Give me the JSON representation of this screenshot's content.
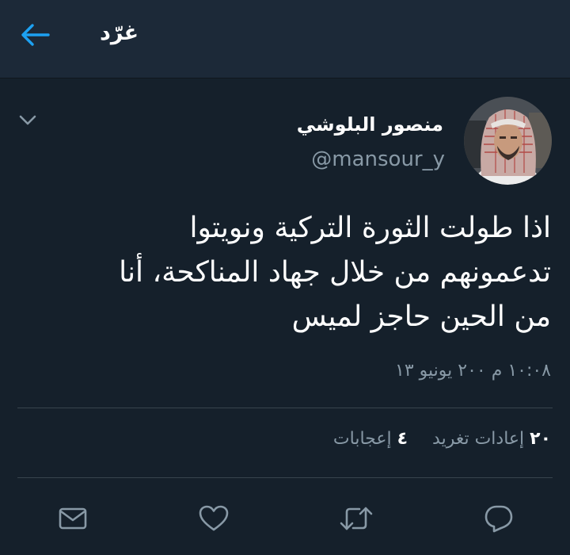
{
  "header": {
    "title": "غرّد"
  },
  "tweet": {
    "display_name": "منصور البلوشي",
    "handle": "@mansour_y",
    "text_lines": [
      "اذا طولت الثورة التركية ونويتوا",
      "تدعمونهم من خلال جهاد المناكحة، أنا",
      "من الحين حاجز لميس"
    ],
    "timestamp": "١٠:٠٨ م ٢٠٠ يونيو ١٣"
  },
  "stats": {
    "retweets_count": "٢٠",
    "retweets_label": "إعادات تغريد",
    "likes_count": "٤",
    "likes_label": "إعجابات"
  },
  "icons": {
    "back": "arrow-left-icon",
    "menu": "chevron-down-icon",
    "share": "mail-icon",
    "like": "heart-icon",
    "retweet": "retweet-icon",
    "reply": "reply-icon"
  },
  "colors": {
    "background": "#15202b",
    "header_background": "#1c2938",
    "accent": "#1da1f2",
    "secondary_text": "#8899a6",
    "divider": "#38444d"
  }
}
